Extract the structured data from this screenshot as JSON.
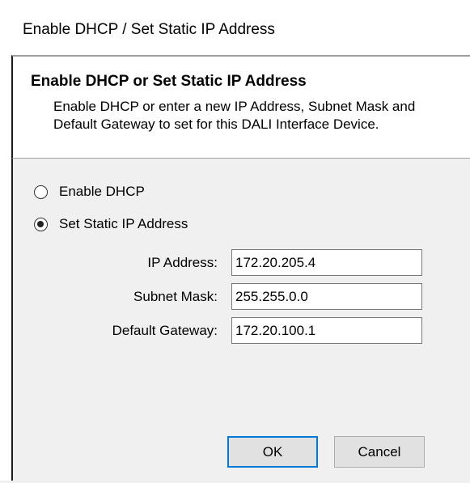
{
  "window": {
    "title": "Enable DHCP / Set Static IP Address"
  },
  "header": {
    "title": "Enable DHCP or Set Static IP Address",
    "description": "Enable DHCP or enter a new IP Address, Subnet Mask and Default Gateway to set for this DALI Interface Device."
  },
  "options": {
    "dhcp_label": "Enable DHCP",
    "dhcp_selected": false,
    "static_label": "Set Static IP Address",
    "static_selected": true
  },
  "fields": {
    "ip_label": "IP Address:",
    "ip_value": "172.20.205.4",
    "subnet_label": "Subnet Mask:",
    "subnet_value": "255.255.0.0",
    "gateway_label": "Default Gateway:",
    "gateway_value": "172.20.100.1"
  },
  "buttons": {
    "ok_label": "OK",
    "cancel_label": "Cancel"
  },
  "colors": {
    "panel_bg": "#f0f0f0",
    "default_button_border": "#0078d7"
  }
}
